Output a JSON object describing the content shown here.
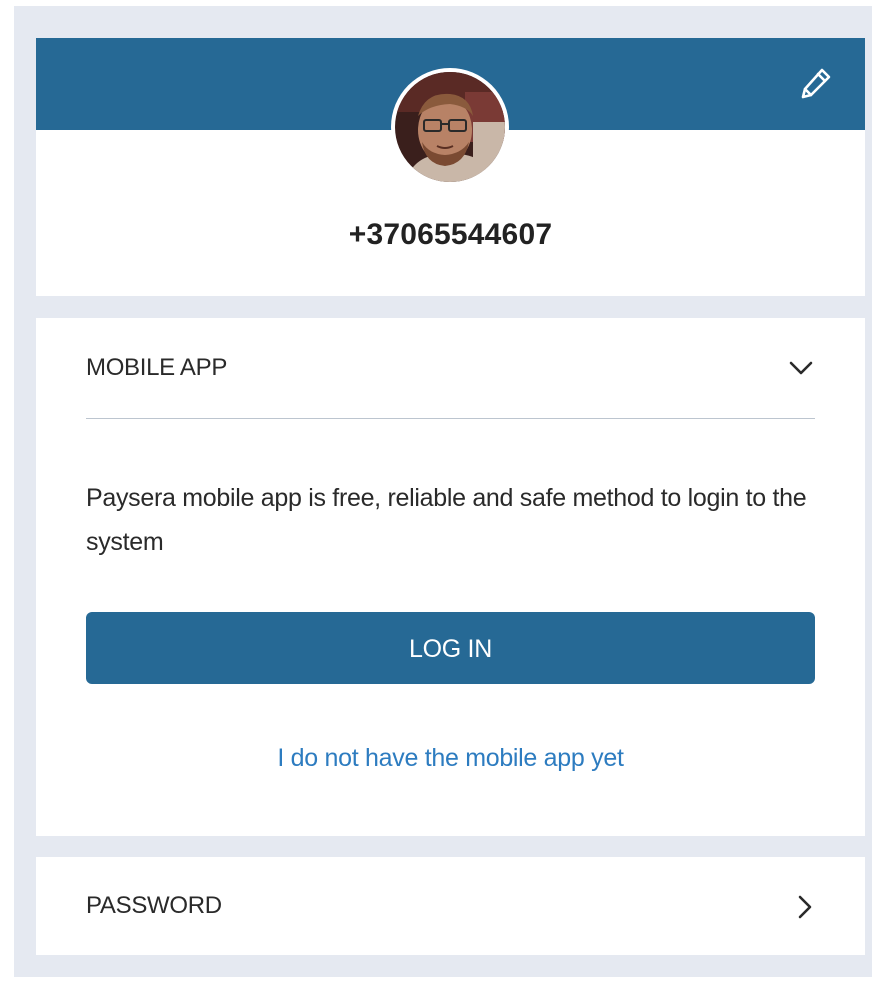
{
  "profile": {
    "phone": "+37065544607",
    "banner_color": "#266995",
    "edit_icon": "pencil-icon",
    "avatar": "user-photo"
  },
  "mobile_app": {
    "title": "MOBILE APP",
    "expanded": true,
    "toggle_icon": "chevron-down-icon",
    "description": "Paysera mobile app is free, reliable and safe method to login to the system",
    "login_label": "LOG IN",
    "no_app_link": "I do not have the mobile app yet"
  },
  "password": {
    "title": "PASSWORD",
    "toggle_icon": "chevron-right-icon"
  },
  "colors": {
    "accent": "#266995",
    "link": "#2d7cc0",
    "background": "#e5e9f1"
  }
}
